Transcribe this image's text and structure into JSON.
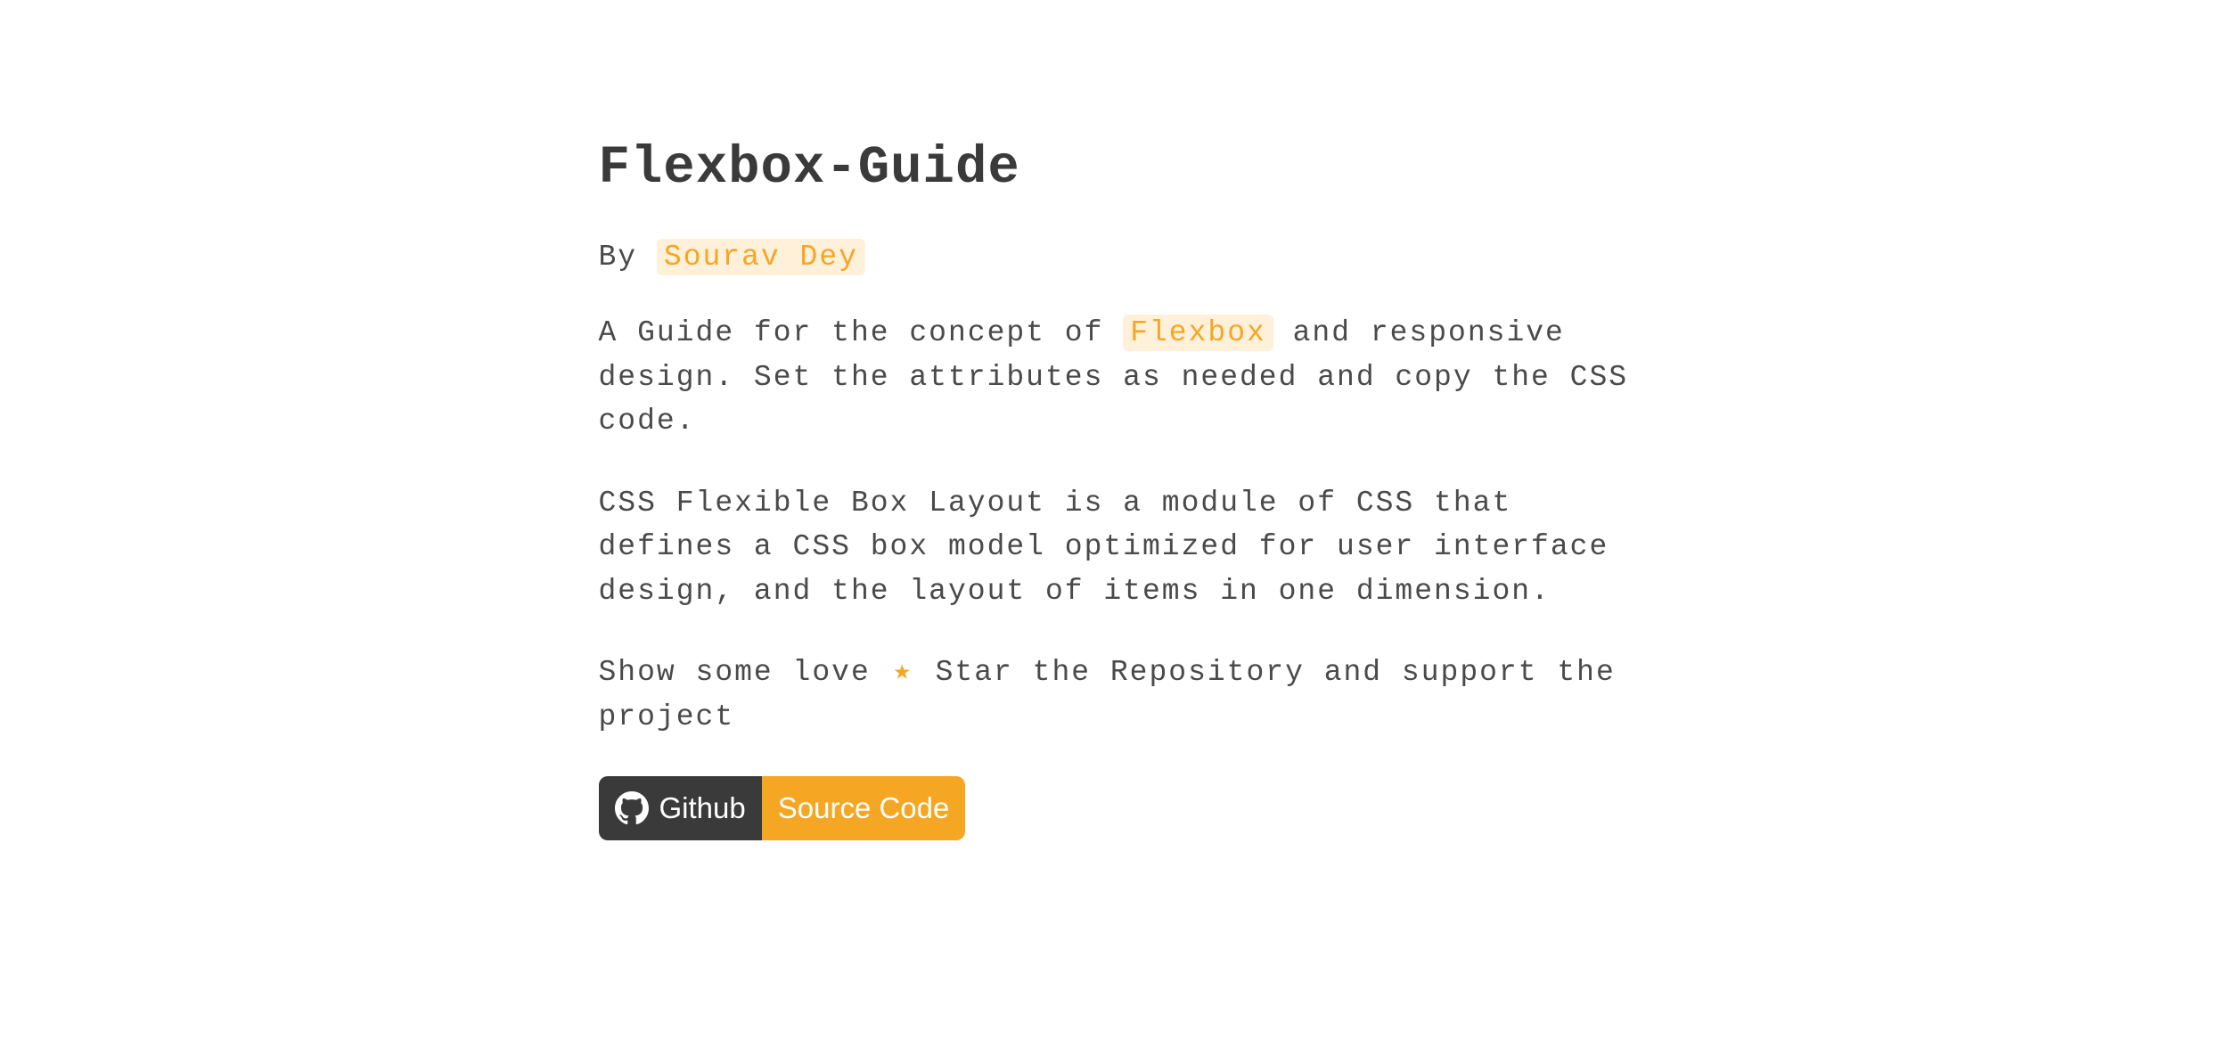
{
  "title": "Flexbox-Guide",
  "byline": {
    "prefix": "By ",
    "author": "Sourav Dey"
  },
  "paragraph1": {
    "prefix": "A Guide for the concept of ",
    "highlight": "Flexbox",
    "suffix": " and responsive design. Set the attributes as needed and copy the CSS code."
  },
  "paragraph2": "CSS Flexible Box Layout is a module of CSS that defines a CSS box model optimized for user interface design, and the layout of items in one dimension.",
  "paragraph3": {
    "prefix": "Show some love ",
    "suffix": " Star the Repository and support the project"
  },
  "github_button": {
    "left_label": "Github",
    "right_label": "Source Code"
  }
}
